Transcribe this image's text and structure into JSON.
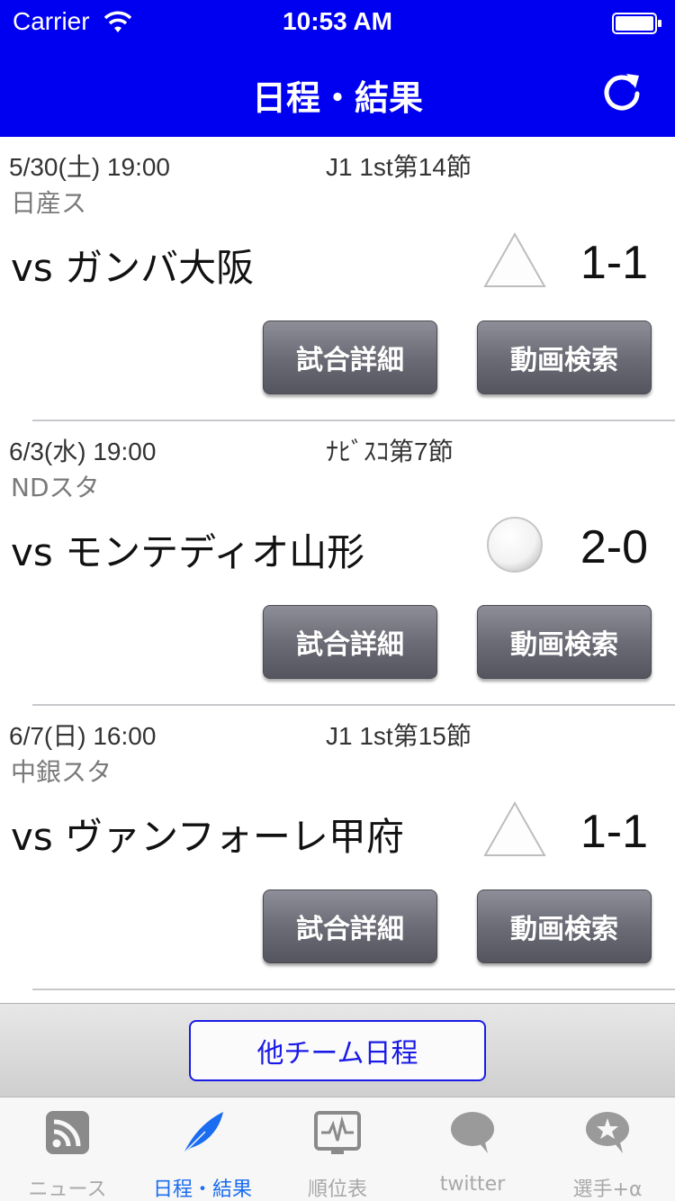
{
  "status_bar": {
    "carrier": "Carrier",
    "time": "10:53 AM"
  },
  "nav": {
    "title": "日程・結果",
    "refresh_icon": "refresh-icon"
  },
  "matches": [
    {
      "datetime": "5/30(土) 19:00",
      "competition": "J1 1st第14節",
      "venue": "日産ス",
      "opponent": "vs ガンバ大阪",
      "result": "draw",
      "score": "1-1",
      "detail_label": "試合詳細",
      "video_label": "動画検索"
    },
    {
      "datetime": "6/3(水) 19:00",
      "competition": "ﾅﾋﾞｽｺ第7節",
      "venue": "NDスタ",
      "opponent": "vs モンテディオ山形",
      "result": "win",
      "score": "2-0",
      "detail_label": "試合詳細",
      "video_label": "動画検索"
    },
    {
      "datetime": "6/7(日) 16:00",
      "competition": "J1 1st第15節",
      "venue": "中銀スタ",
      "opponent": "vs ヴァンフォーレ甲府",
      "result": "draw",
      "score": "1-1",
      "detail_label": "試合詳細",
      "video_label": "動画検索"
    }
  ],
  "bottom": {
    "other_team_label": "他チーム日程"
  },
  "tabs": [
    {
      "label": "ニュース",
      "icon": "rss-icon",
      "active": false
    },
    {
      "label": "日程・結果",
      "icon": "feather-icon",
      "active": true
    },
    {
      "label": "順位表",
      "icon": "chart-monitor-icon",
      "active": false
    },
    {
      "label": "twitter",
      "icon": "speech-bubble-icon",
      "active": false
    },
    {
      "label": "選手+α",
      "icon": "star-bubble-icon",
      "active": false
    }
  ],
  "colors": {
    "header": "#0000f0",
    "tab_active": "#1a6cf0",
    "tab_inactive": "#a8a8a8"
  }
}
